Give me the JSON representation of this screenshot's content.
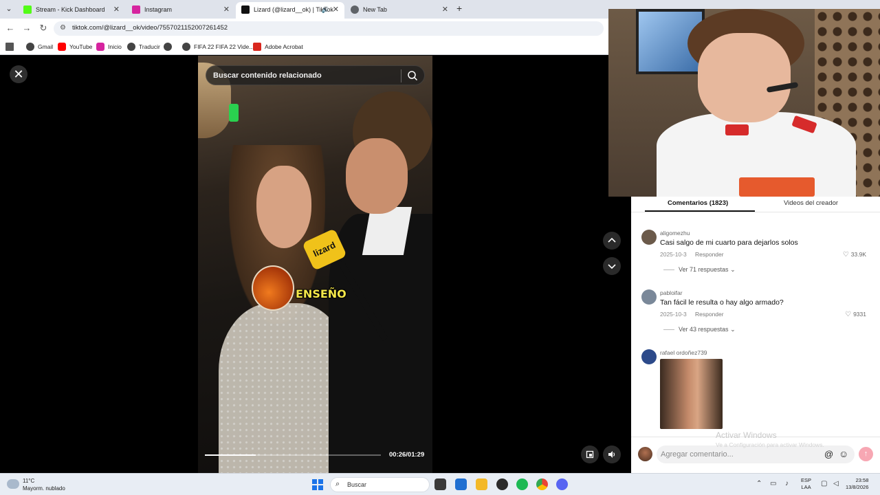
{
  "browser": {
    "tabs": [
      {
        "title": "Stream - Kick Dashboard",
        "favicon_color": "#53fc18"
      },
      {
        "title": "Instagram",
        "favicon_color": "#d6249f"
      },
      {
        "title": "Lizard (@lizard__ok) | TikTok",
        "favicon_color": "#111111"
      },
      {
        "title": "New Tab",
        "favicon_color": "#5f6368"
      }
    ],
    "url": "tiktok.com/@lizard__ok/video/7557021152007261452",
    "bookmarks": [
      {
        "label": "Gmail",
        "color": "#444444"
      },
      {
        "label": "YouTube",
        "color": "#ff0000"
      },
      {
        "label": "Inicio",
        "color": "#d6249f"
      },
      {
        "label": "Traducir",
        "color": "#444444"
      },
      {
        "label": "",
        "color": "#444444"
      },
      {
        "label": "FIFA 22 FIFA 22 Vide...",
        "color": "#444444"
      },
      {
        "label": "Adobe Acrobat",
        "color": "#d9271e"
      }
    ]
  },
  "video": {
    "search_placeholder": "Buscar contenido relacionado",
    "caption": "ENSEÑO",
    "mic_label": "lizard",
    "time": "00:26/01:29",
    "progress": 0.29
  },
  "comments": {
    "tabs": [
      "Comentarios (1823)",
      "Videos del creador"
    ],
    "items": [
      {
        "user": "aligomezhu",
        "text": "Casi salgo de mi cuarto para dejarlos solos",
        "date": "2025-10-3",
        "reply": "Responder",
        "likes": "33.9K",
        "view_replies": "Ver 71 respuestas",
        "avatar_color": "#6b5a4a"
      },
      {
        "user": "pabloifar",
        "text": "Tan fácil le resulta o hay algo armado?",
        "date": "2025-10-3",
        "reply": "Responder",
        "likes": "9331",
        "view_replies": "Ver 43 respuestas",
        "avatar_color": "#7a8899"
      },
      {
        "user": "rafael ordoñez739",
        "avatar_color": "#2c4a8a"
      }
    ],
    "input_placeholder": "Agregar comentario...",
    "watermark_title": "Activar Windows",
    "watermark_sub": "Ve a Configuración para activar Windows."
  },
  "taskbar": {
    "temp": "11°C",
    "condition": "Mayorm. nublado",
    "search_label": "Buscar",
    "lang_top": "ESP",
    "lang_bottom": "LAA",
    "time": "23:58",
    "date": "13/8/2026"
  }
}
